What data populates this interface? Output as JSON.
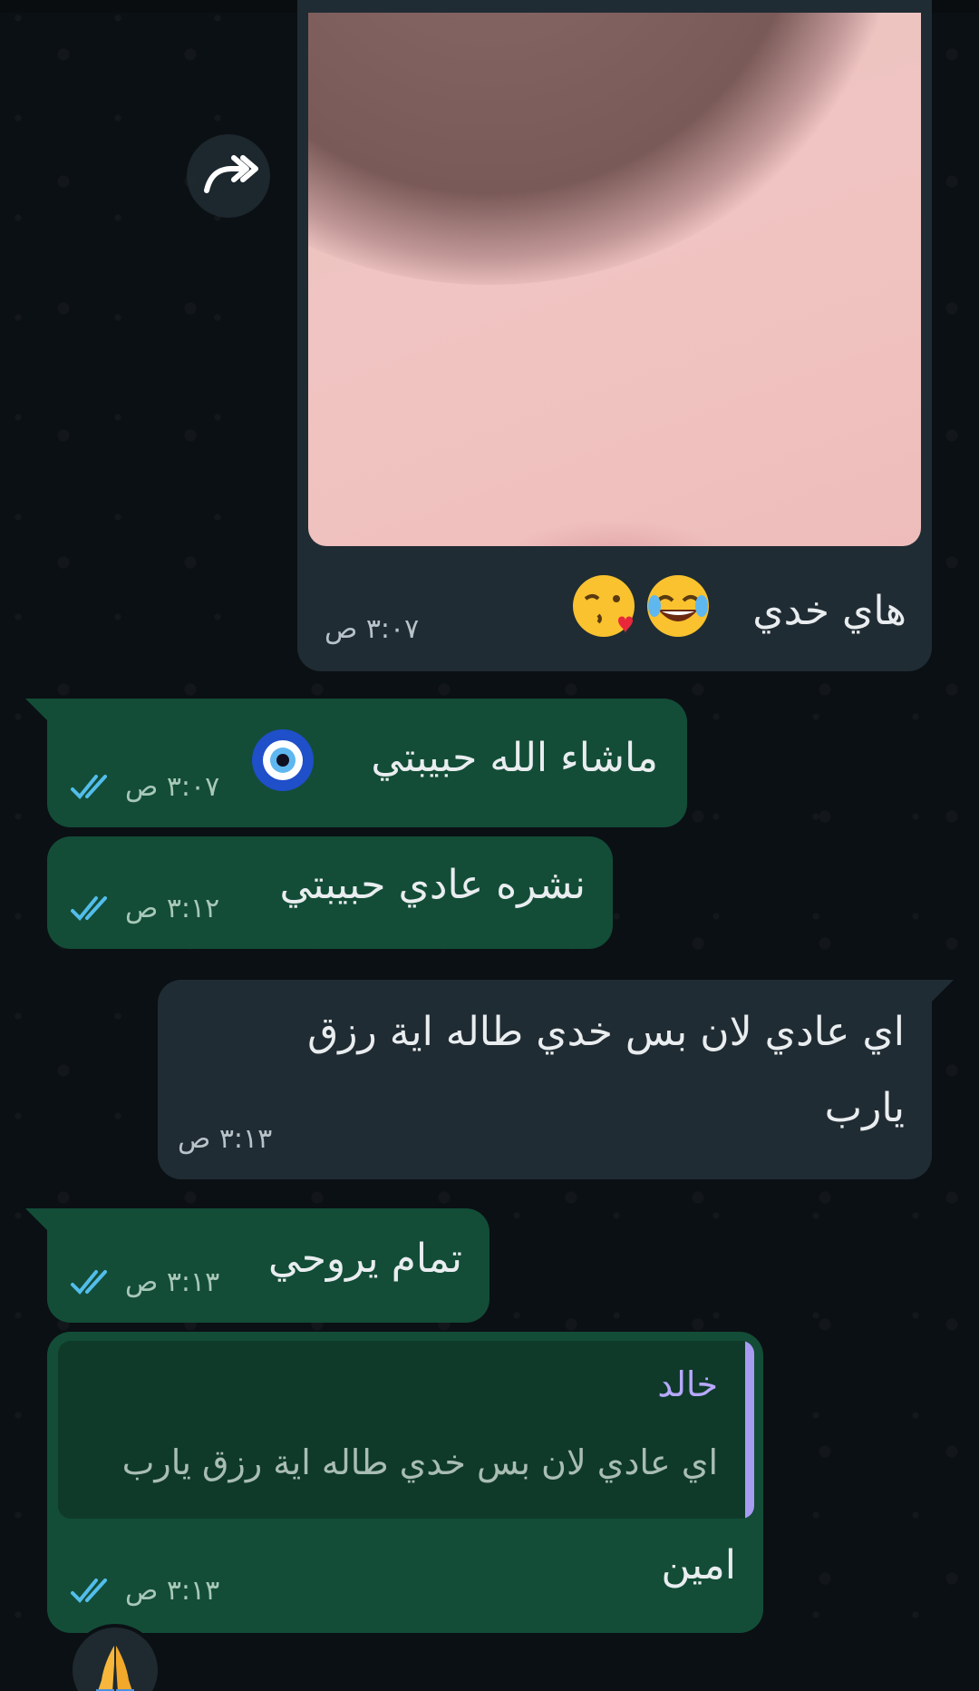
{
  "messages": [
    {
      "id": "m1",
      "direction": "incoming",
      "type": "image",
      "caption": "هاي خدي",
      "caption_emojis": [
        "face-with-tears-of-joy",
        "face-blowing-a-kiss"
      ],
      "time": "٣:٠٧ ص"
    },
    {
      "id": "m2",
      "direction": "outgoing",
      "text": "ماشاء الله حبيبتي",
      "emoji": "nazar-amulet",
      "time": "٣:٠٧ ص",
      "status": "read"
    },
    {
      "id": "m3",
      "direction": "outgoing",
      "text": "نشره عادي حبيبتي",
      "time": "٣:١٢ ص",
      "status": "read"
    },
    {
      "id": "m4",
      "direction": "incoming",
      "text_line1": "اي عادي لان بس خدي طاله اية رزق",
      "text_line2": "يارب",
      "time": "٣:١٣ ص"
    },
    {
      "id": "m5",
      "direction": "outgoing",
      "text": "تمام يروحي",
      "time": "٣:١٣ ص",
      "status": "read"
    },
    {
      "id": "m6",
      "direction": "outgoing",
      "quote": {
        "author": "خالد",
        "text": "اي عادي لان بس خدي طاله اية رزق يارب"
      },
      "text": "امين",
      "time": "٣:١٣ ص",
      "status": "read",
      "reaction": "folded-hands"
    }
  ],
  "icons": {
    "forward": "forward-icon",
    "read_ticks": "double-check-icon"
  },
  "colors": {
    "background": "#0b1014",
    "incoming": "#202c33",
    "outgoing": "#134d37",
    "read_tick": "#53bdeb",
    "quote_bar": "#a79cf2"
  }
}
